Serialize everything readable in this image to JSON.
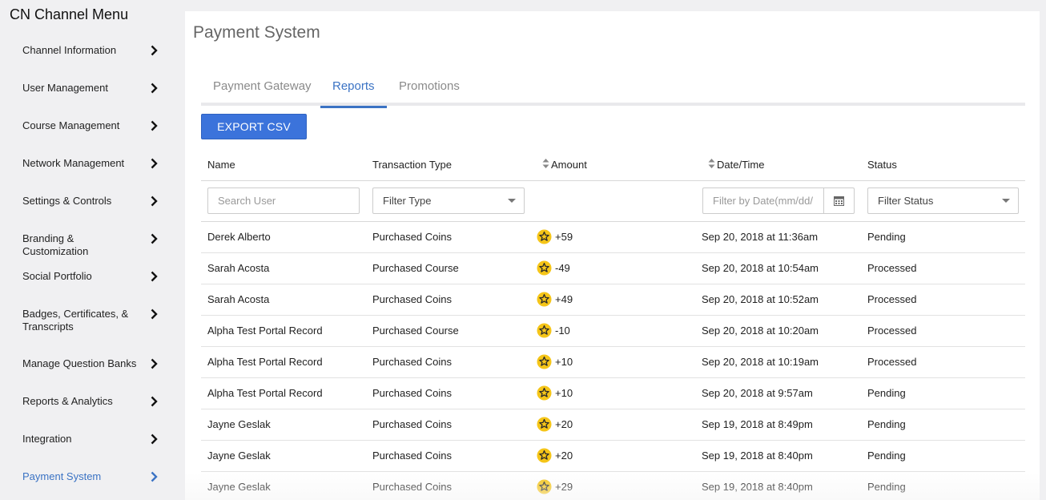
{
  "sidebar": {
    "title": "CN Channel Menu",
    "items": [
      {
        "label": "Channel Information"
      },
      {
        "label": "User Management"
      },
      {
        "label": "Course Management"
      },
      {
        "label": "Network Management"
      },
      {
        "label": "Settings & Controls"
      },
      {
        "label": "Branding & Customization"
      },
      {
        "label": "Social Portfolio"
      },
      {
        "label": "Badges, Certificates, & Transcripts"
      },
      {
        "label": "Manage Question Banks"
      },
      {
        "label": "Reports & Analytics"
      },
      {
        "label": "Integration"
      },
      {
        "label": "Payment System"
      }
    ],
    "active_color": "#3b73c4"
  },
  "page": {
    "title": "Payment System",
    "tabs": [
      {
        "label": "Payment Gateway"
      },
      {
        "label": "Reports"
      },
      {
        "label": "Promotions"
      }
    ],
    "active_tab": "Reports",
    "export_label": "EXPORT CSV",
    "accent": "#3b73db"
  },
  "table": {
    "headers": {
      "name": "Name",
      "type": "Transaction Type",
      "amount": "Amount",
      "date": "Date/Time",
      "status": "Status"
    },
    "filters": {
      "search_placeholder": "Search User",
      "type_placeholder": "Filter Type",
      "date_placeholder": "Filter by Date(mm/dd/",
      "status_placeholder": "Filter Status"
    },
    "rows": [
      {
        "name": "Derek Alberto",
        "type": "Purchased Coins",
        "amount": "+59",
        "date": "Sep 20, 2018 at 11:36am",
        "status": "Pending"
      },
      {
        "name": "Sarah Acosta",
        "type": "Purchased Course",
        "amount": "-49",
        "date": "Sep 20, 2018 at 10:54am",
        "status": "Processed"
      },
      {
        "name": "Sarah Acosta",
        "type": "Purchased Coins",
        "amount": "+49",
        "date": "Sep 20, 2018 at 10:52am",
        "status": "Processed"
      },
      {
        "name": "Alpha Test Portal Record",
        "type": "Purchased Course",
        "amount": "-10",
        "date": "Sep 20, 2018 at 10:20am",
        "status": "Processed"
      },
      {
        "name": "Alpha Test Portal Record",
        "type": "Purchased Coins",
        "amount": "+10",
        "date": "Sep 20, 2018 at 10:19am",
        "status": "Processed"
      },
      {
        "name": "Alpha Test Portal Record",
        "type": "Purchased Coins",
        "amount": "+10",
        "date": "Sep 20, 2018 at 9:57am",
        "status": "Pending"
      },
      {
        "name": "Jayne Geslak",
        "type": "Purchased Coins",
        "amount": "+20",
        "date": "Sep 19, 2018 at 8:49pm",
        "status": "Pending"
      },
      {
        "name": "Jayne Geslak",
        "type": "Purchased Coins",
        "amount": "+20",
        "date": "Sep 19, 2018 at 8:40pm",
        "status": "Pending"
      },
      {
        "name": "Jayne Geslak",
        "type": "Purchased Coins",
        "amount": "+29",
        "date": "Sep 19, 2018 at 8:40pm",
        "status": "Pending"
      }
    ],
    "coin_icon": "star-coin-icon",
    "coin_color": "#f5c518"
  }
}
